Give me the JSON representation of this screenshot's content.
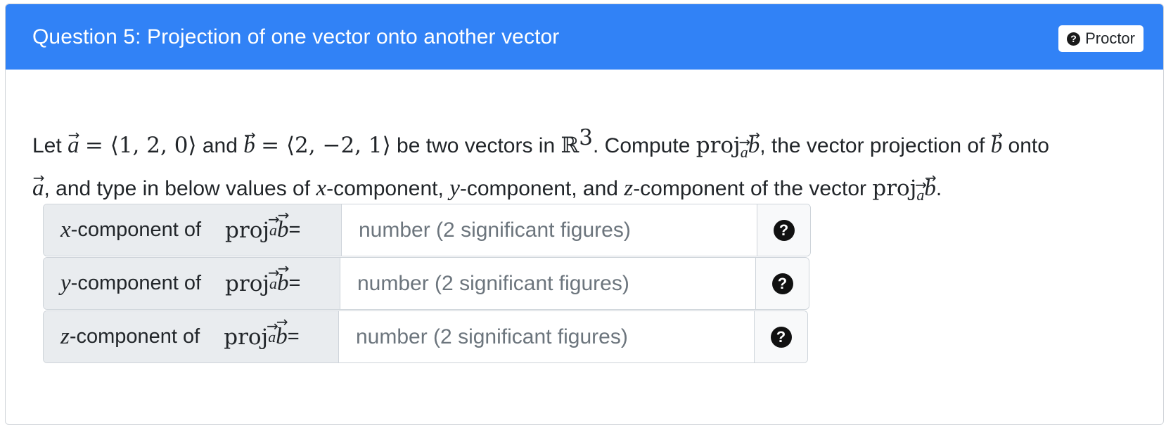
{
  "header": {
    "title": "Question 5: Projection of one vector onto another vector",
    "proctor_label": "Proctor",
    "proctor_icon": "question-circle-icon"
  },
  "prompt": {
    "let": "Let",
    "a_name": "a",
    "a_eq": "= ⟨1, 2, 0⟩",
    "and1": "and",
    "b_name": "b",
    "b_eq": "= ⟨2, −2, 1⟩",
    "be_two": "be two vectors in",
    "space": "ℝ",
    "space_dim": "3",
    "compute": ". Compute",
    "proj": "proj",
    "proj_sub": "a",
    "proj_of": "b",
    "the_vector": ", the vector projection of",
    "b_name2": "b",
    "onto": "onto",
    "a_name2": "a",
    "type_in": ", and type in below values of",
    "x": "x",
    "comp1": "-component,",
    "y": "y",
    "comp2": "-component, and",
    "z": "z",
    "comp3": "-component of the vector",
    "end": "."
  },
  "answers": [
    {
      "var": "x",
      "label_text": "-component of",
      "proj": "proj",
      "sub": "a",
      "vec": "b",
      "eq": "=",
      "placeholder": "number (2 significant figures)",
      "value": ""
    },
    {
      "var": "y",
      "label_text": "-component of",
      "proj": "proj",
      "sub": "a",
      "vec": "b",
      "eq": "=",
      "placeholder": "number (2 significant figures)",
      "value": ""
    },
    {
      "var": "z",
      "label_text": "-component of",
      "proj": "proj",
      "sub": "a",
      "vec": "b",
      "eq": "=",
      "placeholder": "number (2 significant figures)",
      "value": ""
    }
  ],
  "colors": {
    "header_bg": "#3182f6",
    "label_bg": "#e9ecef",
    "placeholder": "#6c757d"
  }
}
